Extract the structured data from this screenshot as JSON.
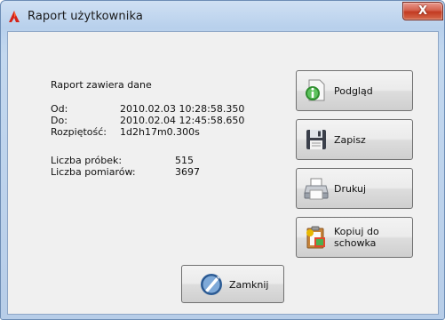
{
  "window": {
    "title": "Raport użytkownika",
    "close_glyph": "X"
  },
  "report": {
    "heading": "Raport zawiera dane",
    "od_label": "Od:",
    "od_value": "2010.02.03 10:28:58.350",
    "do_label": "Do:",
    "do_value": "2010.02.04 12:45:58.650",
    "range_label": "Rozpiętość:",
    "range_value": "1d2h17m0.300s",
    "samples_label": "Liczba próbek:",
    "samples_value": "515",
    "measurements_label": "Liczba pomiarów:",
    "measurements_value": "3697"
  },
  "buttons": {
    "preview": "Podgląd",
    "save": "Zapisz",
    "print": "Drukuj",
    "copy_line1": "Kopiuj do",
    "copy_line2": "schowka",
    "close": "Zamknij"
  },
  "icons": {
    "app": "app-logo-icon",
    "preview": "preview-info-icon",
    "save": "floppy-disk-icon",
    "print": "printer-icon",
    "copy": "clipboard-copy-icon",
    "close": "close-circle-icon"
  }
}
